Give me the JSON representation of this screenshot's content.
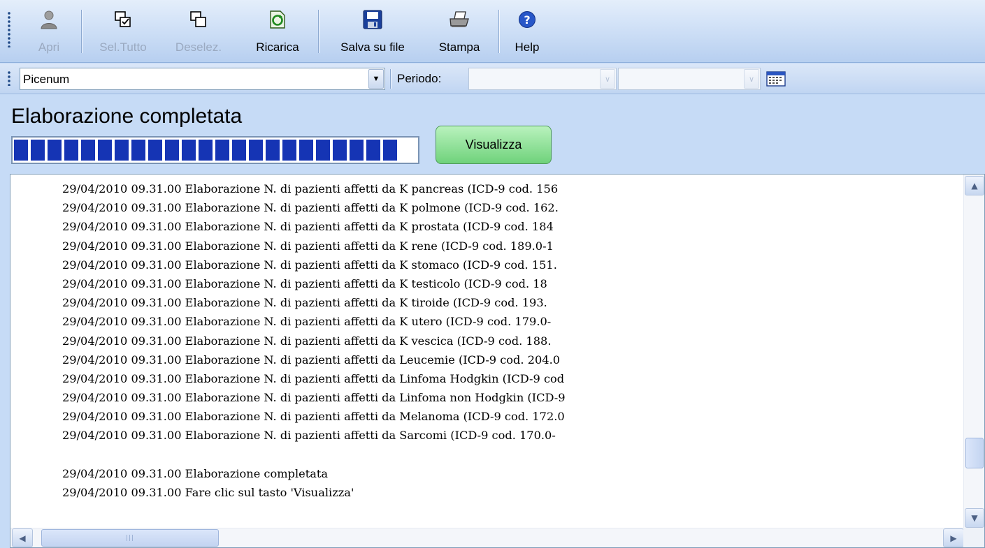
{
  "toolbar": {
    "buttons": [
      {
        "label": "Apri",
        "icon": "user-icon",
        "enabled": false
      },
      {
        "label": "Sel.Tutto",
        "icon": "select-all-icon",
        "enabled": false
      },
      {
        "label": "Deselez.",
        "icon": "deselect-icon",
        "enabled": false
      },
      {
        "label": "Ricarica",
        "icon": "refresh-icon",
        "enabled": true
      },
      {
        "label": "Salva su file",
        "icon": "floppy-disk-icon",
        "enabled": true
      },
      {
        "label": "Stampa",
        "icon": "printer-icon",
        "enabled": true
      },
      {
        "label": "Help",
        "icon": "help-icon",
        "enabled": true
      }
    ]
  },
  "filter": {
    "source_value": "Picenum",
    "periodo_label": "Periodo:",
    "periodo_start": "",
    "periodo_end": ""
  },
  "status": {
    "title": "Elaborazione completata",
    "progress_fraction": 1.0,
    "visualizza_label": "Visualizza"
  },
  "log": {
    "lines": [
      "29/04/2010 09.31.00 Elaborazione N. di pazienti affetti da K pancreas (ICD-9 cod. 156",
      "29/04/2010 09.31.00 Elaborazione N. di pazienti affetti da K polmone (ICD-9 cod. 162.",
      "29/04/2010 09.31.00 Elaborazione N. di pazienti affetti da K prostata (ICD-9 cod. 184",
      "29/04/2010 09.31.00 Elaborazione N. di pazienti affetti da K rene (ICD-9 cod. 189.0-1",
      "29/04/2010 09.31.00 Elaborazione N. di pazienti affetti da K stomaco (ICD-9 cod. 151.",
      "29/04/2010 09.31.00 Elaborazione N. di pazienti affetti da K testicolo (ICD-9 cod. 18",
      "29/04/2010 09.31.00 Elaborazione N. di pazienti affetti da K tiroide (ICD-9 cod. 193.",
      "29/04/2010 09.31.00 Elaborazione N. di pazienti affetti da K utero (ICD-9 cod. 179.0-",
      "29/04/2010 09.31.00 Elaborazione N. di pazienti affetti da K vescica (ICD-9 cod. 188.",
      "29/04/2010 09.31.00 Elaborazione N. di pazienti affetti da Leucemie (ICD-9 cod. 204.0",
      "29/04/2010 09.31.00 Elaborazione N. di pazienti affetti da Linfoma Hodgkin (ICD-9 cod",
      "29/04/2010 09.31.00 Elaborazione N. di pazienti affetti da Linfoma non Hodgkin (ICD-9",
      "29/04/2010 09.31.00 Elaborazione N. di pazienti affetti da Melanoma (ICD-9 cod. 172.0",
      "29/04/2010 09.31.00 Elaborazione N. di pazienti affetti da Sarcomi (ICD-9 cod. 170.0-",
      "",
      "29/04/2010 09.31.00 Elaborazione completata",
      "29/04/2010 09.31.00 Fare clic sul tasto 'Visualizza'"
    ]
  },
  "colors": {
    "window_bg": "#c6dbf6",
    "progress_fill": "#1534b4",
    "visualizza_button": "#8fe09a"
  }
}
